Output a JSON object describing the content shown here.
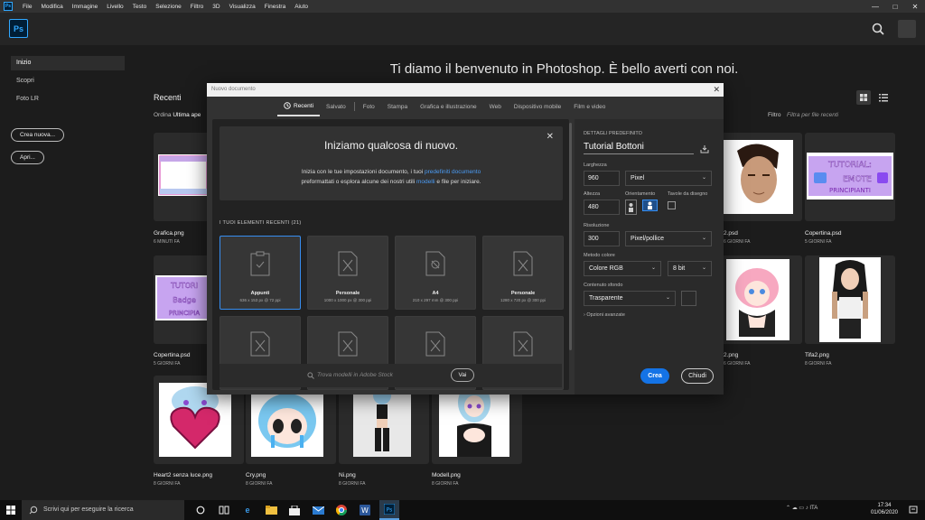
{
  "menubar": {
    "logo": "Ps",
    "items": [
      "File",
      "Modifica",
      "Immagine",
      "Livello",
      "Testo",
      "Selezione",
      "Filtro",
      "3D",
      "Visualizza",
      "Finestra",
      "Aiuto"
    ],
    "window_controls": [
      "—",
      "□",
      "✕"
    ]
  },
  "home": {
    "logo": "Ps",
    "welcome": "Ti diamo il benvenuto in Photoshop. È bello averti con noi.",
    "nav": [
      "Inizio",
      "Scopri",
      "Foto LR"
    ],
    "buttons": {
      "create": "Crea nuova...",
      "open": "Apri..."
    },
    "recent_title": "Recenti",
    "order_label": "Ordina",
    "order_value": "Ultima ape",
    "filter_label": "Filtro",
    "filter_placeholder": "Filtra per file recenti"
  },
  "files": [
    {
      "name": "Grafica.png",
      "time": "6 MINUTI FA",
      "thumb": "grafica"
    },
    {
      "name": "2.psd",
      "time": "6 GIORNI FA",
      "thumb": "face"
    },
    {
      "name": "Copertina.psd",
      "time": "5 GIORNI FA",
      "thumb": "tut-emote",
      "label": "TUTORIAL: EMOTE PRINCIPIANTI"
    },
    {
      "name": "Copertina.psd",
      "time": "5 GIORNI FA",
      "thumb": "tut-badge",
      "label": "TUTORIAL Badge PRINCIPIA"
    },
    {
      "name": "2.png",
      "time": "6 GIORNI FA",
      "thumb": "pink"
    },
    {
      "name": "Tifa2.png",
      "time": "8 GIORNI FA",
      "thumb": "tifa"
    },
    {
      "name": "Heart2 senza luce.png",
      "time": "8 GIORNI FA",
      "thumb": "heart"
    },
    {
      "name": "Cry.png",
      "time": "8 GIORNI FA",
      "thumb": "cry"
    },
    {
      "name": "Ni.png",
      "time": "8 GIORNI FA",
      "thumb": "ni"
    },
    {
      "name": "Modell.png",
      "time": "8 GIORNI FA",
      "thumb": "modell"
    }
  ],
  "dialog": {
    "title": "Nuovo documento",
    "tabs": [
      "Recenti",
      "Salvato",
      "Foto",
      "Stampa",
      "Grafica e illustrazione",
      "Web",
      "Dispositivo mobile",
      "Film e video"
    ],
    "banner": {
      "title": "Iniziamo qualcosa di nuovo.",
      "line1_a": "Inizia con le tue impostazioni documento, i tuoi ",
      "line1_link": "predefiniti documento",
      "line2_a": "preformattati o esplora alcune dei nostri utili ",
      "line2_link": "modelli",
      "line2_b": " e file per iniziare."
    },
    "recent_label": "I TUOI ELEMENTI RECENTI",
    "recent_count": "(21)",
    "presets": [
      {
        "name": "Appunti",
        "dim": "636 x 153 px @ 72 ppi",
        "icon": "clipboard"
      },
      {
        "name": "Personale",
        "dim": "1000 x 1000 px @ 300 ppi",
        "icon": "doc-x"
      },
      {
        "name": "A4",
        "dim": "210 x 297 mm @ 300 ppi",
        "icon": "doc-a4"
      },
      {
        "name": "Personale",
        "dim": "1280 x 720 px @ 300 ppi",
        "icon": "doc-x"
      },
      {
        "name": "",
        "dim": "",
        "icon": "doc-x"
      },
      {
        "name": "",
        "dim": "",
        "icon": "doc-x"
      },
      {
        "name": "",
        "dim": "",
        "icon": "doc-x"
      },
      {
        "name": "",
        "dim": "",
        "icon": "doc-x"
      }
    ],
    "stock_placeholder": "Trova modelli in Adobe Stock",
    "stock_button": "Vai",
    "details": {
      "header": "DETTAGLI PREDEFINITO",
      "name": "Tutorial Bottoni",
      "width_label": "Larghezza",
      "width": "960",
      "width_unit": "Pixel",
      "height_label": "Altezza",
      "height": "480",
      "orientation_label": "Orientamento",
      "artboards_label": "Tavole da disegno",
      "resolution_label": "Risoluzione",
      "resolution": "300",
      "resolution_unit": "Pixel/pollice",
      "color_mode_label": "Metodo colore",
      "color_mode": "Colore RGB",
      "bit_depth": "8 bit",
      "bg_label": "Contenuto sfondo",
      "bg": "Trasparente",
      "advanced": "Opzioni avanzate",
      "create": "Crea",
      "close": "Chiudi"
    }
  },
  "taskbar": {
    "search": "Scrivi qui per eseguire la ricerca",
    "lang": "ITA",
    "time": "17:34",
    "date": "01/06/2020"
  },
  "colors": {
    "accent": "#1473e6",
    "link": "#4b9cf5",
    "ps": "#31a8ff"
  }
}
